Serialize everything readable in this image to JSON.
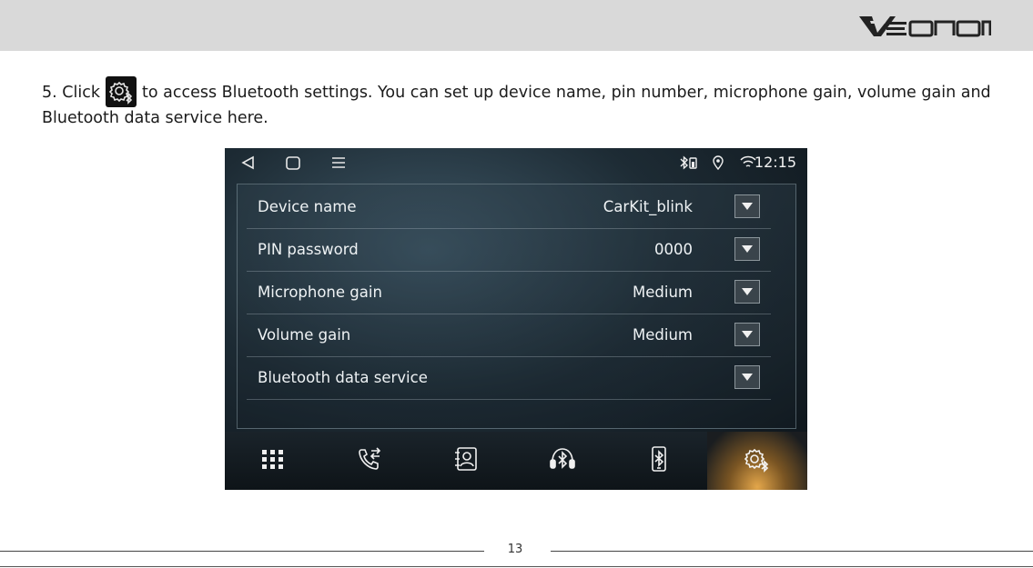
{
  "header": {
    "brand": "Eonon"
  },
  "instruction": {
    "prefix": "5. Click",
    "icon": "bluetooth-settings-icon",
    "suffix": "to access Bluetooth settings. You can set up device name, pin number, microphone gain, volume gain and Bluetooth data service here."
  },
  "screen": {
    "status": {
      "time": "12:15",
      "icons": [
        "bluetooth-battery-icon",
        "location-pin-icon",
        "wifi-icon"
      ]
    },
    "nav_icons": [
      "back-icon",
      "home-icon",
      "menu-icon"
    ],
    "settings": [
      {
        "label": "Device name",
        "value": "CarKit_blink"
      },
      {
        "label": "PIN password",
        "value": "0000"
      },
      {
        "label": "Microphone gain",
        "value": "Medium"
      },
      {
        "label": "Volume gain",
        "value": "Medium"
      },
      {
        "label": "Bluetooth data service",
        "value": ""
      }
    ],
    "tabs": [
      {
        "icon": "dialpad-icon",
        "active": false
      },
      {
        "icon": "call-log-icon",
        "active": false
      },
      {
        "icon": "contacts-icon",
        "active": false
      },
      {
        "icon": "bluetooth-music-icon",
        "active": false
      },
      {
        "icon": "bluetooth-phone-icon",
        "active": false
      },
      {
        "icon": "bluetooth-settings-icon",
        "active": true
      }
    ],
    "active_tab_color": "#e3a64a"
  },
  "footer": {
    "page_number": "13"
  }
}
